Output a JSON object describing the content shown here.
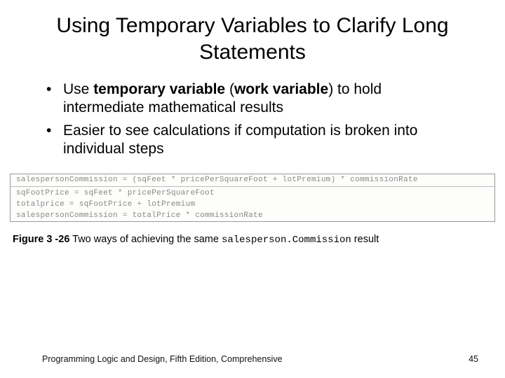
{
  "title": "Using Temporary Variables to Clarify Long Statements",
  "bullets": [
    {
      "pre": "Use ",
      "strong": "temporary variable",
      "mid": " (",
      "strong2": "work variable",
      "post": ") to hold intermediate mathematical results"
    },
    {
      "text": "Easier to see calculations if computation is broken into individual steps"
    }
  ],
  "code": {
    "line1": "salespersonCommission = (sqFeet * pricePerSquareFoot + lotPremium) * commissionRate",
    "line2": "sqFootPrice = sqFeet * pricePerSquareFoot",
    "line3": "totalprice = sqFootPrice + lotPremium",
    "line4": "salespersonCommission = totalPrice * commissionRate"
  },
  "caption": {
    "label": "Figure 3 -26",
    "body": "  Two ways of achieving the same ",
    "code": "salesperson.Commission",
    "tail": " result"
  },
  "footer": {
    "left": "Programming Logic and Design, Fifth Edition, Comprehensive",
    "right": "45"
  }
}
